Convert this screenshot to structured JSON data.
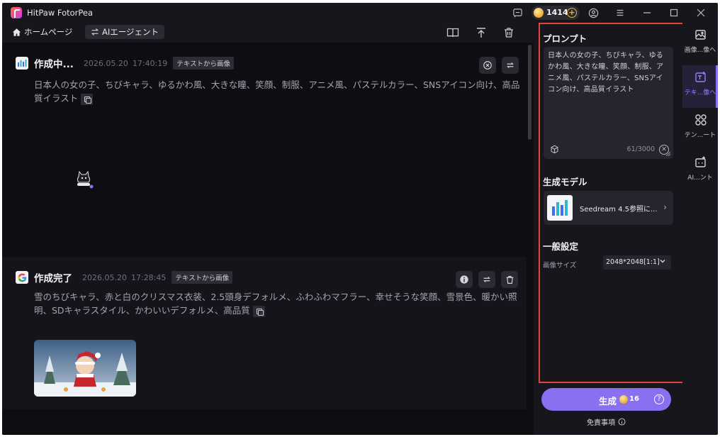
{
  "app": {
    "title": "HitPaw FotorPea",
    "credits": "1414"
  },
  "toolbar": {
    "home_label": "ホームページ",
    "agent_label": "AIエージェント"
  },
  "feed": {
    "items": [
      {
        "status": "作成中...",
        "date": "2026.05.20",
        "time": "17:40:19",
        "mode": "テキストから画像",
        "prompt": "日本人の女の子、ちびキャラ、ゆるかわ風、大きな瞳、笑顔、制服、アニメ風、パステルカラー、SNSアイコン向け、高品質イラスト"
      },
      {
        "status": "作成完了",
        "date": "2026.05.20",
        "time": "17:28:45",
        "mode": "テキストから画像",
        "prompt": "雪のちびキャラ、赤と白のクリスマス衣装、2.5頭身デフォルメ、ふわふわマフラー、幸せそうな笑顔、雪景色、暖かい照明、SDキャラスタイル、かわいいデフォルメ、高品質"
      }
    ]
  },
  "panel": {
    "prompt_title": "プロンプト",
    "prompt_text": "日本人の女の子、ちびキャラ、ゆるかわ風、大きな瞳、笑顔、制服、アニメ風、パステルカラー、SNSアイコン向け、高品質イラスト",
    "char_count": "61/3000",
    "model_title": "生成モデル",
    "model_name": "Seedream 4.5参照に...",
    "settings_title": "一般設定",
    "size_label": "画像サイズ",
    "size_value": "2048*2048[1:1]"
  },
  "generate": {
    "label": "生成",
    "cost": "16",
    "disclaimer": "免責事項"
  },
  "sidenav": {
    "items": [
      {
        "label": "画像...像へ",
        "icon": "image-icon"
      },
      {
        "label": "テキ...像へ",
        "icon": "text-to-image-icon"
      },
      {
        "label": "テン...ート",
        "icon": "template-icon"
      },
      {
        "label": "AI...ント",
        "icon": "ai-agent-icon"
      }
    ]
  },
  "colors": {
    "accent": "#8a6ff0",
    "highlight_border": "#e2453b",
    "background": "#16161c"
  }
}
